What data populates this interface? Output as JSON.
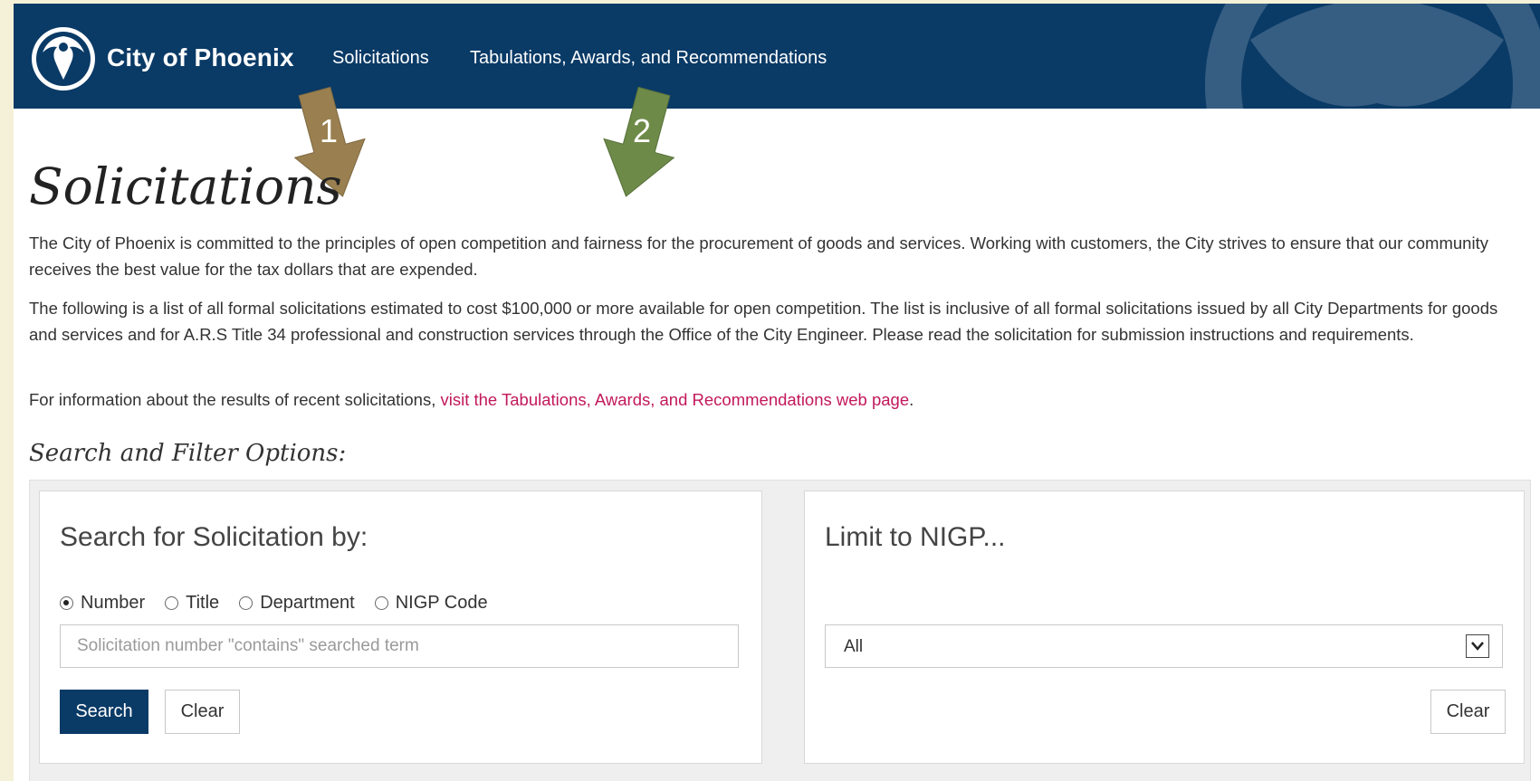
{
  "nav": {
    "brand": "City of Phoenix",
    "links": [
      "Solicitations",
      "Tabulations, Awards, and Recommendations"
    ]
  },
  "annotations": [
    "1",
    "2"
  ],
  "page": {
    "title": "Solicitations",
    "paragraph1": "The City of Phoenix is committed to the principles of open competition and fairness for the procurement of goods and services. Working with customers, the City strives to ensure that our community receives the best value for the tax dollars that are expended.",
    "paragraph2": "The following is a list of all formal solicitations estimated to cost $100,000 or more available for open competition. The list is inclusive of all formal solicitations issued by all City Departments for goods and services and for A.R.S Title 34 professional and construction services through the Office of the City Engineer. Please read the solicitation for submission instructions and requirements.",
    "paragraph3_prefix": "For information about the results of recent solicitations, ",
    "paragraph3_link": "visit the Tabulations, Awards, and Recommendations web page",
    "paragraph3_suffix": "."
  },
  "filters": {
    "title": "Search and Filter Options:",
    "search_panel": {
      "heading": "Search for Solicitation by:",
      "radio_options": [
        "Number",
        "Title",
        "Department",
        "NIGP Code"
      ],
      "selected_option": "Number",
      "input_placeholder": "Solicitation number \"contains\" searched term",
      "input_value": "",
      "search_button": "Search",
      "clear_button": "Clear"
    },
    "nigp_panel": {
      "heading": "Limit to NIGP...",
      "select_value": "All",
      "clear_button": "Clear"
    }
  },
  "colors": {
    "navbar": "#0a3a66",
    "link": "#c2185b",
    "arrow1": "#9a8050",
    "arrow2": "#6e8a48",
    "frame_background": "#f4f1d8"
  }
}
